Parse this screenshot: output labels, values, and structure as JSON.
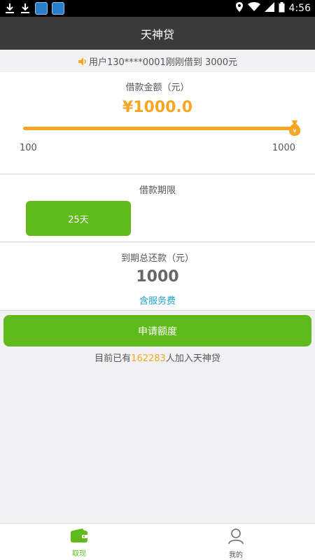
{
  "status_bar": {
    "time": "4:56"
  },
  "header": {
    "title": "天神贷"
  },
  "notice": {
    "text": "用户130****0001刚刚借到 3000元"
  },
  "loan_amount": {
    "label": "借款金额（元）",
    "value": "¥1000.0",
    "min_label": "100",
    "max_label": "1000",
    "slider_fraction": 1.0
  },
  "loan_term": {
    "label": "借款期限",
    "option": "25天"
  },
  "repayment": {
    "label": "到期总还款（元）",
    "value": "1000",
    "note": "含服务费"
  },
  "apply": {
    "label": "申请额度"
  },
  "joined": {
    "prefix": "目前已有",
    "count": "162283",
    "suffix": "人加入天神贷"
  },
  "tabs": [
    {
      "label": "取现"
    },
    {
      "label": "我的"
    }
  ],
  "colors": {
    "accent_green": "#5fba1c",
    "accent_orange": "#f5a623",
    "link_blue": "#1aa3c9"
  }
}
